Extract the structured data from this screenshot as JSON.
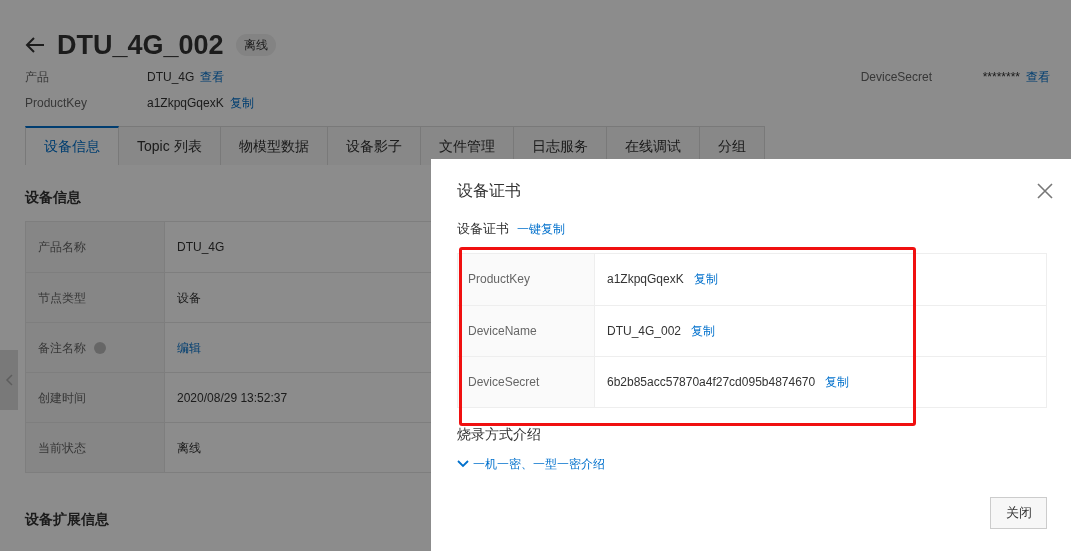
{
  "header": {
    "title": "DTU_4G_002",
    "status": "离线"
  },
  "meta": [
    {
      "label": "产品",
      "value": "DTU_4G",
      "link": "查看"
    },
    {
      "label": "ProductKey",
      "value": "a1ZkpqGqexK",
      "link": "复制"
    }
  ],
  "meta_right": {
    "label": "DeviceSecret",
    "value": "********",
    "link": "查看"
  },
  "tabs": [
    {
      "label": "设备信息",
      "selected": true
    },
    {
      "label": "Topic 列表",
      "selected": false
    },
    {
      "label": "物模型数据",
      "selected": false
    },
    {
      "label": "设备影子",
      "selected": false
    },
    {
      "label": "文件管理",
      "selected": false
    },
    {
      "label": "日志服务",
      "selected": false
    },
    {
      "label": "在线调试",
      "selected": false
    },
    {
      "label": "分组",
      "selected": false
    }
  ],
  "section_title": "设备信息",
  "info_rows": [
    {
      "label": "产品名称",
      "value": "DTU_4G",
      "kind": "text"
    },
    {
      "label": "节点类型",
      "value": "设备",
      "kind": "text"
    },
    {
      "label": "备注名称",
      "value": "编辑",
      "kind": "link",
      "help": true
    },
    {
      "label": "创建时间",
      "value": "2020/08/29 13:52:37",
      "kind": "text"
    },
    {
      "label": "当前状态",
      "value": "离线",
      "kind": "text"
    }
  ],
  "section_title_2": "设备扩展信息",
  "dialog": {
    "title": "设备证书",
    "subtitle": "设备证书",
    "copy_all": "一键复制",
    "rows": [
      {
        "label": "ProductKey",
        "value": "a1ZkpqGqexK",
        "action": "复制"
      },
      {
        "label": "DeviceName",
        "value": "DTU_4G_002",
        "action": "复制"
      },
      {
        "label": "DeviceSecret",
        "value": "6b2b85acc57870a4f27cd095b4874670",
        "action": "复制"
      }
    ],
    "burn_title": "烧录方式介绍",
    "burn_link": "一机一密、一型一密介绍",
    "expanded": false,
    "close_button": "关闭"
  }
}
